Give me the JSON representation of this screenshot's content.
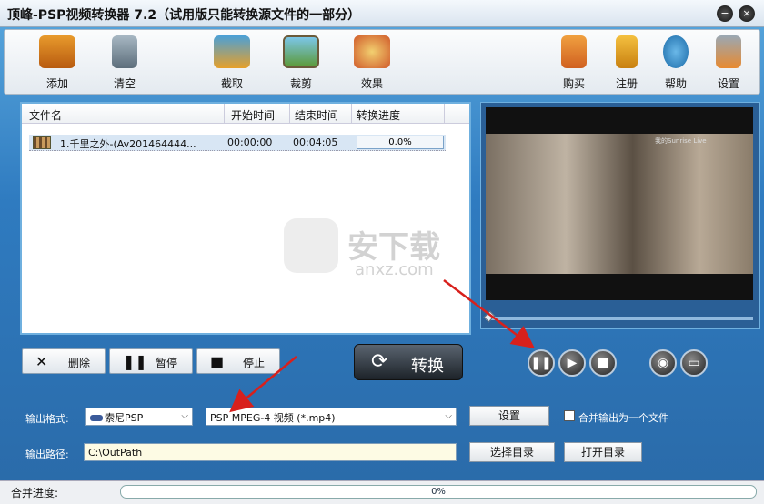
{
  "window": {
    "title": "顶峰-PSP视频转换器 7.2（试用版只能转换源文件的一部分）"
  },
  "toolbar": {
    "add": "添加",
    "clear": "清空",
    "capture": "截取",
    "crop": "裁剪",
    "effect": "效果",
    "buy": "购买",
    "register": "注册",
    "help": "帮助",
    "settings": "设置"
  },
  "filelist": {
    "headers": [
      "文件名",
      "开始时间",
      "结束时间",
      "转换进度"
    ],
    "rows": [
      {
        "name": "1.千里之外-(Av201464444...",
        "start": "00:00:00",
        "end": "00:04:05",
        "progress": "0.0%"
      }
    ]
  },
  "actions": {
    "delete": "删除",
    "pause": "暂停",
    "stop": "停止",
    "convert": "转换"
  },
  "preview": {
    "watermark": "我的Sunrise Live"
  },
  "watermark": {
    "brand": "安下载",
    "domain": "anxz.com"
  },
  "output": {
    "format_label": "输出格式:",
    "device": "索尼PSP",
    "format": "PSP MPEG-4 视频 (*.mp4)",
    "settings_btn": "设置",
    "merge_label": "合并输出为一个文件",
    "path_label": "输出路径:",
    "path": "C:\\OutPath",
    "choose_dir": "选择目录",
    "open_dir": "打开目录"
  },
  "status": {
    "label": "合并进度:",
    "progress": "0%"
  }
}
